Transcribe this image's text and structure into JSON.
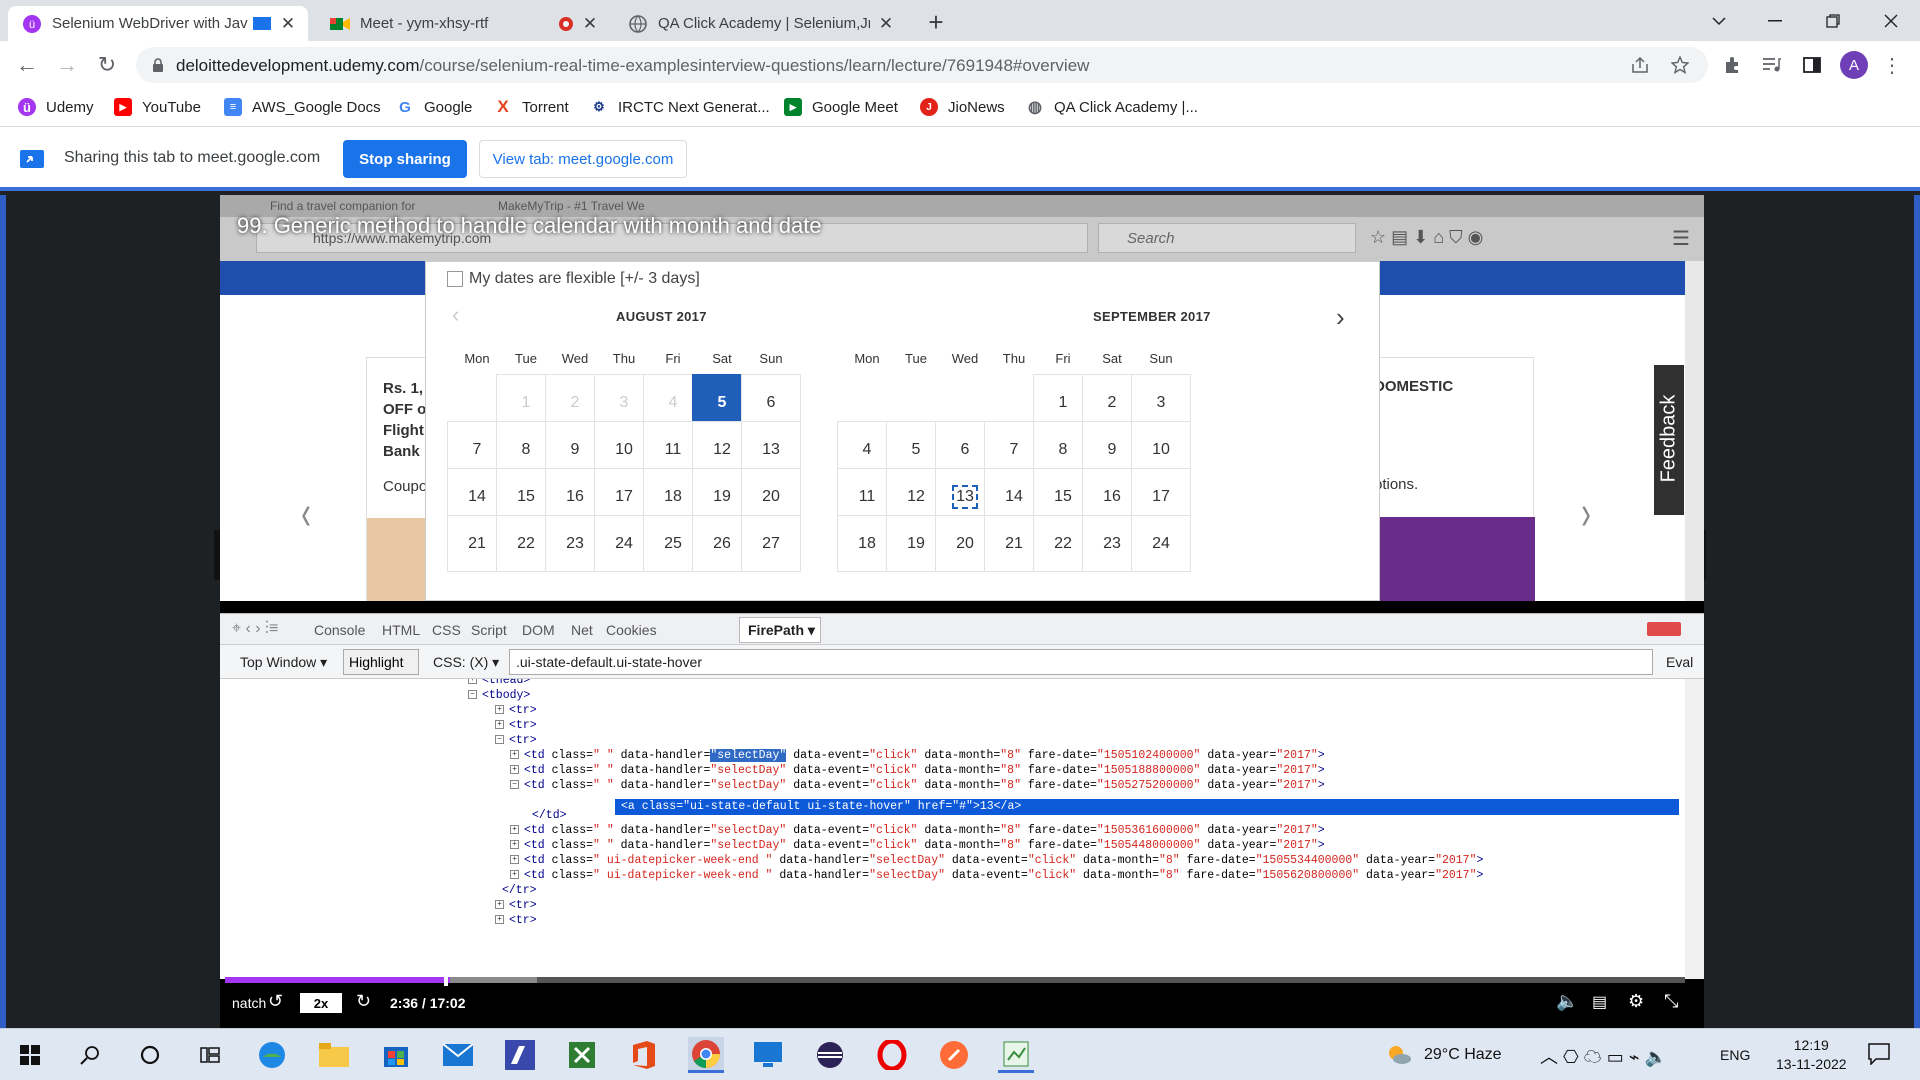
{
  "tabs": [
    {
      "title": "Selenium WebDriver with Jav",
      "active": true
    },
    {
      "title": "Meet - yym-xhsy-rtf",
      "active": false
    },
    {
      "title": "QA Click Academy | Selenium,Jm",
      "active": false
    }
  ],
  "address": {
    "host": "deloittedevelopment.udemy.com",
    "path": "/course/selenium-real-time-examplesinterview-questions/learn/lecture/7691948#overview"
  },
  "profile_initial": "A",
  "bookmarks": [
    "Udemy",
    "YouTube",
    "AWS_Google Docs",
    "Google",
    "Torrent",
    "IRCTC Next Generat...",
    "Google Meet",
    "JioNews",
    "QA Click Academy |..."
  ],
  "share": {
    "text": "Sharing this tab to meet.google.com",
    "stop_label": "Stop sharing",
    "view_label": "View tab: meet.google.com"
  },
  "video": {
    "lecture_title": "99. Generic method to handle calendar with month and date",
    "ff_tabs": [
      "Find a travel companion for",
      "MakeMyTrip - #1 Travel We"
    ],
    "ff_url": "https://www.makemytrip.com",
    "ff_search": "Search",
    "flexible_label": "My dates are flexible [+/- 3 days]",
    "months": [
      {
        "title": "AUGUST 2017",
        "days": [
          "Mon",
          "Tue",
          "Wed",
          "Thu",
          "Fri",
          "Sat",
          "Sun"
        ],
        "rows": [
          [
            "",
            "1",
            "2",
            "3",
            "4",
            "5",
            "6"
          ],
          [
            "7",
            "8",
            "9",
            "10",
            "11",
            "12",
            "13"
          ],
          [
            "14",
            "15",
            "16",
            "17",
            "18",
            "19",
            "20"
          ],
          [
            "21",
            "22",
            "23",
            "24",
            "25",
            "26",
            "27"
          ]
        ]
      },
      {
        "title": "SEPTEMBER 2017",
        "days": [
          "Mon",
          "Tue",
          "Wed",
          "Thu",
          "Fri",
          "Sat",
          "Sun"
        ],
        "rows": [
          [
            "",
            "",
            "",
            "",
            "1",
            "2",
            "3"
          ],
          [
            "4",
            "5",
            "6",
            "7",
            "8",
            "9",
            "10"
          ],
          [
            "11",
            "12",
            "13",
            "14",
            "15",
            "16",
            "17"
          ],
          [
            "18",
            "19",
            "20",
            "21",
            "22",
            "23",
            "24"
          ]
        ]
      }
    ],
    "left_card": [
      "Rs. 1,",
      "OFF o",
      "Flight",
      "Bank",
      "Coupo"
    ],
    "right_card": [
      "DOMESTIC",
      "ptions."
    ],
    "feedback": "Feedback",
    "firebug_tabs": [
      "Console",
      "HTML",
      "CSS",
      "Script",
      "DOM",
      "Net",
      "Cookies"
    ],
    "firepath_tab": "FirePath",
    "top_window": "Top Window",
    "highlight": "Highlight",
    "css_label": "CSS: (X)",
    "selector": ".ui-state-default.ui-state-hover",
    "eval": "Eval",
    "code": {
      "thead": "<thead>",
      "tbody": "<tbody>",
      "tr": "<tr>",
      "tr_close": "</tr>",
      "td_close": "</td>",
      "selected_anchor": "<a class=\"ui-state-default ui-state-hover\" href=\"#\">13</a>",
      "td_rows": [
        {
          "cls": " ",
          "dates": "1505102400000",
          "highlight": true
        },
        {
          "cls": " ",
          "dates": "1505188800000",
          "highlight": false
        },
        {
          "cls": " ",
          "dates": "1505275200000",
          "highlight": false
        },
        {
          "cls": " ",
          "dates": "1505361600000",
          "highlight": false
        },
        {
          "cls": " ",
          "dates": "1505448000000",
          "highlight": false
        },
        {
          "cls": " ui-datepicker-week-end ",
          "dates": "1505534400000",
          "highlight": false
        },
        {
          "cls": " ui-datepicker-week-end ",
          "dates": "1505620800000",
          "highlight": false
        }
      ]
    },
    "time": "2:36 / 17:02",
    "speed": "2x",
    "caption_snip": "natch"
  },
  "taskbar": {
    "weather": "29°C  Haze",
    "lang": "ENG",
    "time": "12:19",
    "date": "13-11-2022"
  }
}
